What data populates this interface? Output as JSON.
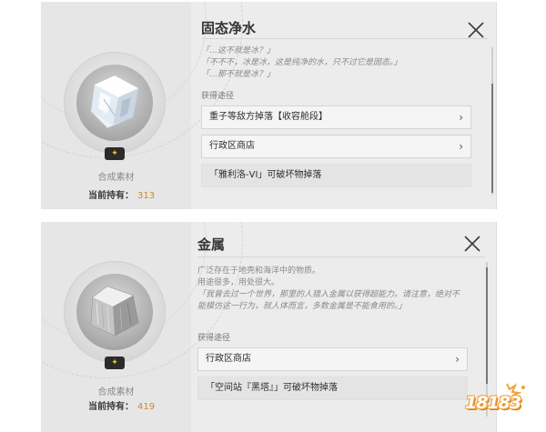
{
  "items": [
    {
      "title": "固态净水",
      "description": [
        "「…这不就是冰？」",
        "「不不不，冰是冰，这是纯净的水，只不过它是固态。」",
        "「…那不就是冰？」"
      ],
      "sources_label": "获得途径",
      "sources": [
        {
          "label": "重子等敌方掉落【收容舱段】",
          "clickable": true
        },
        {
          "label": "行政区商店",
          "clickable": true
        },
        {
          "label": "「雅利洛-VI」可破坏物掉落",
          "clickable": false
        }
      ],
      "category": "合成素材",
      "owned_label": "当前持有：",
      "owned_count": "313",
      "icon": "ice-cube-icon",
      "rarity_icon": "star-icon"
    },
    {
      "title": "金属",
      "description": [
        "广泛存在于地壳和海洋中的物质。",
        "用途很多，用处很大。"
      ],
      "quote": [
        "「我曾去过一个世界，那里的人猎入金属以获得超能力。请注意，绝对不",
        "能模仿这一行为，就人体而言，多数金属是不能食用的。」"
      ],
      "sources_label": "获得途径",
      "sources": [
        {
          "label": "行政区商店",
          "clickable": true
        },
        {
          "label": "「空间站『黑塔』」可破坏物掉落",
          "clickable": false
        }
      ],
      "category": "合成素材",
      "owned_label": "当前持有：",
      "owned_count": "419",
      "icon": "metal-cube-icon",
      "rarity_icon": "star-icon"
    }
  ],
  "watermark": "18183",
  "colors": {
    "panel_bg": "#ececec",
    "count": "#c88a2a",
    "badge_star": "#f2c230",
    "watermark": "#f2a23a"
  }
}
